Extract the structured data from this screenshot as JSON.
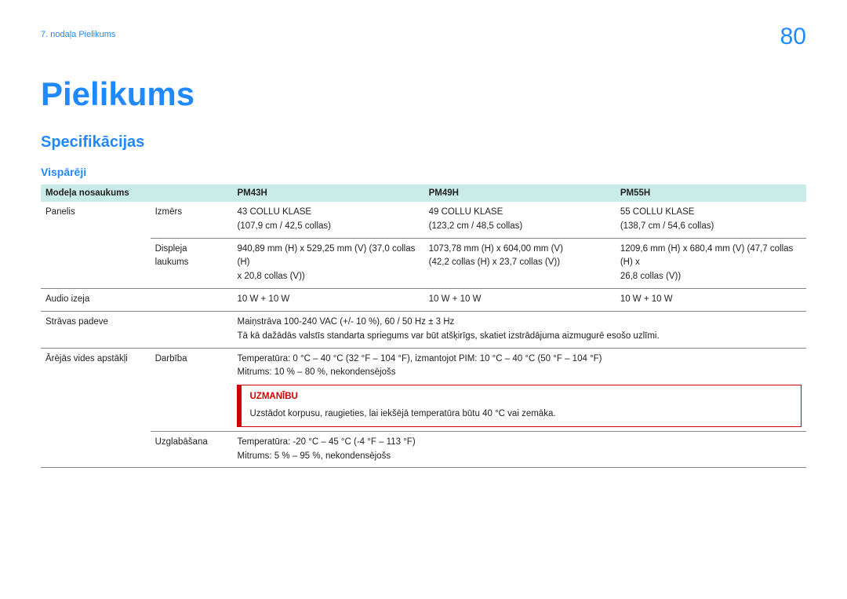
{
  "header": {
    "breadcrumb": "7. nodaļa Pielikums",
    "page_number": "80"
  },
  "title": "Pielikums",
  "section": "Specifikācijas",
  "subsection": "Vispārēji",
  "table": {
    "head": {
      "c0": "Modeļa nosaukums",
      "c1": "PM43H",
      "c2": "PM49H",
      "c3": "PM55H"
    },
    "panel": {
      "label": "Panelis",
      "size_label": "Izmērs",
      "size": {
        "pm43": "43 COLLU KLASE",
        "pm43_sub": "(107,9 cm / 42,5 collas)",
        "pm49": "49 COLLU KLASE",
        "pm49_sub": "(123,2 cm / 48,5 collas)",
        "pm55": "55 COLLU KLASE",
        "pm55_sub": "(138,7 cm / 54,6 collas)"
      },
      "area_label_1": "Displeja",
      "area_label_2": "laukums",
      "area": {
        "pm43_l1": "940,89 mm (H) x 529,25 mm (V) (37,0 collas (H)",
        "pm43_l2": "x 20,8 collas (V))",
        "pm49_l1": "1073,78 mm (H) x 604,00 mm (V)",
        "pm49_l2": "(42,2 collas (H) x 23,7 collas (V))",
        "pm55_l1": "1209,6 mm (H) x 680,4 mm (V) (47,7 collas (H) x",
        "pm55_l2": "26,8 collas (V))"
      }
    },
    "audio": {
      "label": "Audio izeja",
      "pm43": "10 W + 10 W",
      "pm49": "10 W + 10 W",
      "pm55": "10 W + 10 W"
    },
    "power": {
      "label": "Strāvas padeve",
      "line1": "Maiņstrāva 100-240 VAC (+/- 10 %), 60 / 50 Hz ± 3 Hz",
      "line2": "Tā kā dažādās valstīs standarta spriegums var būt atšķirīgs, skatiet izstrādājuma aizmugurē esošo uzlīmi."
    },
    "env": {
      "label": "Ārējās vides apstākļi",
      "op_label": "Darbība",
      "op_line1": "Temperatūra: 0 °C – 40 °C (32 °F – 104 °F), izmantojot PIM: 10 °C – 40 °C (50 °F – 104 °F)",
      "op_line2": "Mitrums: 10 % – 80 %, nekondensējošs",
      "callout_title": "UZMANĪBU",
      "callout_text": "Uzstādot korpusu, raugieties, lai iekšējā temperatūra būtu 40 °C vai zemāka.",
      "store_label": "Uzglabāšana",
      "store_line1": "Temperatūra: -20 °C – 45 °C (-4 °F – 113 °F)",
      "store_line2": "Mitrums: 5 % – 95 %, nekondensējošs"
    }
  }
}
